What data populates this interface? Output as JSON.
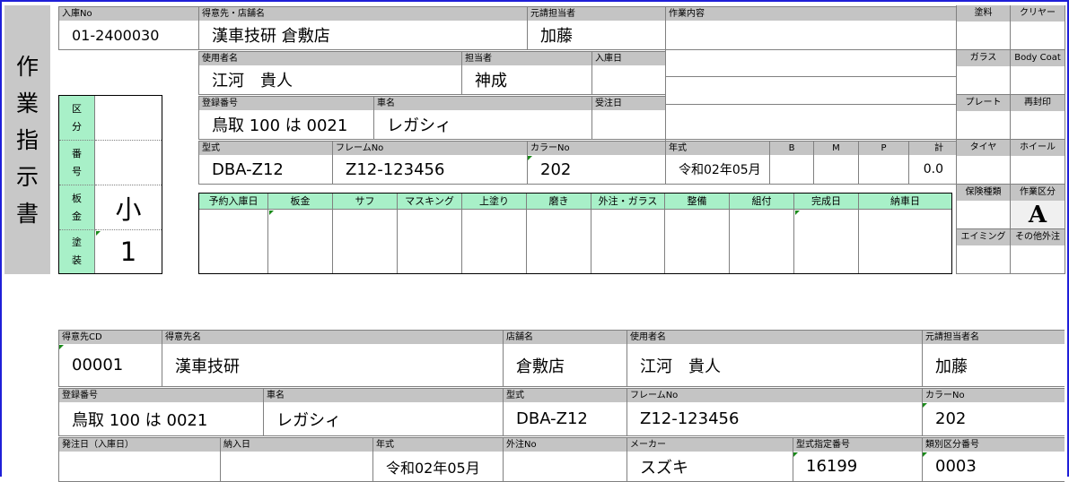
{
  "title": "作業指示書",
  "title_chars": [
    "作",
    "業",
    "指",
    "示",
    "書"
  ],
  "top": {
    "nyuko_no": {
      "label": "入庫No",
      "value": "01-2400030"
    },
    "tokuisaki": {
      "label": "得意先・店舗名",
      "value": "漢車技研 倉敷店"
    },
    "motouke": {
      "label": "元請担当者",
      "value": "加藤"
    },
    "sagyo": {
      "label": "作業内容"
    },
    "shiyosha": {
      "label": "使用者名",
      "value": "江河　貴人"
    },
    "tanto": {
      "label": "担当者",
      "value": "神成"
    },
    "nyukobi": {
      "label": "入庫日",
      "value": ""
    },
    "toroku": {
      "label": "登録番号",
      "value": "鳥取 100 は 0021"
    },
    "shamei": {
      "label": "車名",
      "value": "レガシィ"
    },
    "juchubi": {
      "label": "受注日",
      "value": ""
    },
    "katashiki": {
      "label": "型式",
      "value": "DBA-Z12"
    },
    "frame": {
      "label": "フレームNo",
      "value": "Z12-123456"
    },
    "color": {
      "label": "カラーNo",
      "value": "202"
    },
    "nenshiki": {
      "label": "年式",
      "value": "令和02年05月"
    },
    "b": {
      "label": "B",
      "value": ""
    },
    "m": {
      "label": "M",
      "value": ""
    },
    "p": {
      "label": "P",
      "value": ""
    },
    "kei": {
      "label": "計",
      "value": "0.0"
    }
  },
  "kubun": {
    "kubun_label": [
      "区",
      "分"
    ],
    "bango_label": [
      "番",
      "号"
    ],
    "bankin_label": [
      "板",
      "金"
    ],
    "bankin_value": "小",
    "tosou_label": [
      "塗",
      "装"
    ],
    "tosou_value": "1"
  },
  "schedule": [
    "予約入庫日",
    "板金",
    "サフ",
    "マスキング",
    "上塗り",
    "磨き",
    "外注・ガラス",
    "整備",
    "組付",
    "完成日",
    "納車日"
  ],
  "right": {
    "r1": [
      "塗料",
      "クリヤー"
    ],
    "r2": [
      "ガラス",
      "Body Coat"
    ],
    "r3": [
      "プレート",
      "再封印"
    ],
    "r4": [
      "タイヤ",
      "ホイール"
    ],
    "r5": [
      "保険種類",
      "作業区分"
    ],
    "sagyo_kubun_value": "A",
    "r6": [
      "エイミング",
      "その他外注"
    ]
  },
  "bottom": {
    "tokuisaki_cd": {
      "label": "得意先CD",
      "value": "00001"
    },
    "tokuisaki_mei": {
      "label": "得意先名",
      "value": "漢車技研"
    },
    "tenpo": {
      "label": "店舗名",
      "value": "倉敷店"
    },
    "shiyosha": {
      "label": "使用者名",
      "value": "江河　貴人"
    },
    "motouke": {
      "label": "元請担当者名",
      "value": "加藤"
    },
    "toroku": {
      "label": "登録番号",
      "value": "鳥取 100 は 0021"
    },
    "shamei": {
      "label": "車名",
      "value": "レガシィ"
    },
    "katashiki": {
      "label": "型式",
      "value": "DBA-Z12"
    },
    "frame": {
      "label": "フレームNo",
      "value": "Z12-123456"
    },
    "color": {
      "label": "カラーNo",
      "value": "202"
    },
    "hatchubi": {
      "label": "発注日（入庫日）",
      "value": ""
    },
    "nonyubi": {
      "label": "納入日",
      "value": ""
    },
    "nenshiki": {
      "label": "年式",
      "value": "令和02年05月"
    },
    "gaichu": {
      "label": "外注No",
      "value": ""
    },
    "maker": {
      "label": "メーカー",
      "value": "スズキ"
    },
    "katashiki_shitei": {
      "label": "型式指定番号",
      "value": "16199"
    },
    "ruibetsu": {
      "label": "類別区分番号",
      "value": "0003"
    }
  }
}
